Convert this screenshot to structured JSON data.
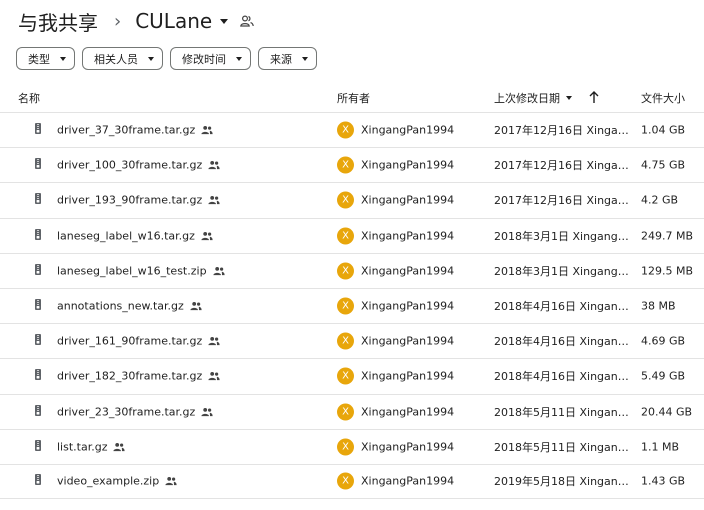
{
  "breadcrumb": {
    "root": "与我共享",
    "separator": "›",
    "current": "CULane"
  },
  "filters": [
    {
      "label": "类型"
    },
    {
      "label": "相关人员"
    },
    {
      "label": "修改时间"
    },
    {
      "label": "来源"
    }
  ],
  "columns": {
    "name": "名称",
    "owner": "所有者",
    "modified": "上次修改日期",
    "size": "文件大小"
  },
  "files": [
    {
      "name": "driver_37_30frame.tar.gz",
      "owner": "XingangPan1994",
      "avatar": "X",
      "modified": "2017年12月16日 XingangPan1994",
      "size": "1.04 GB"
    },
    {
      "name": "driver_100_30frame.tar.gz",
      "owner": "XingangPan1994",
      "avatar": "X",
      "modified": "2017年12月16日 XingangPan1994",
      "size": "4.75 GB"
    },
    {
      "name": "driver_193_90frame.tar.gz",
      "owner": "XingangPan1994",
      "avatar": "X",
      "modified": "2017年12月16日 XingangPan1994",
      "size": "4.2 GB"
    },
    {
      "name": "laneseg_label_w16.tar.gz",
      "owner": "XingangPan1994",
      "avatar": "X",
      "modified": "2018年3月1日 XingangPan1994",
      "size": "249.7 MB"
    },
    {
      "name": "laneseg_label_w16_test.zip",
      "owner": "XingangPan1994",
      "avatar": "X",
      "modified": "2018年3月1日 XingangPan1994",
      "size": "129.5 MB"
    },
    {
      "name": "annotations_new.tar.gz",
      "owner": "XingangPan1994",
      "avatar": "X",
      "modified": "2018年4月16日 XingangPan1994",
      "size": "38 MB"
    },
    {
      "name": "driver_161_90frame.tar.gz",
      "owner": "XingangPan1994",
      "avatar": "X",
      "modified": "2018年4月16日 XingangPan1994",
      "size": "4.69 GB"
    },
    {
      "name": "driver_182_30frame.tar.gz",
      "owner": "XingangPan1994",
      "avatar": "X",
      "modified": "2018年4月16日 XingangPan1994",
      "size": "5.49 GB"
    },
    {
      "name": "driver_23_30frame.tar.gz",
      "owner": "XingangPan1994",
      "avatar": "X",
      "modified": "2018年5月11日 XingangPan1994",
      "size": "20.44 GB"
    },
    {
      "name": "list.tar.gz",
      "owner": "XingangPan1994",
      "avatar": "X",
      "modified": "2018年5月11日 XingangPan1994",
      "size": "1.1 MB"
    },
    {
      "name": "video_example.zip",
      "owner": "XingangPan1994",
      "avatar": "X",
      "modified": "2019年5月18日 XingangPan1994",
      "size": "1.43 GB"
    }
  ],
  "icons": {
    "file": "zip-file-icon",
    "shared": "shared-people-icon",
    "sort": "arrow-up-icon"
  },
  "colors": {
    "avatar": "#e8a60b",
    "divider": "#e3e3e3"
  }
}
